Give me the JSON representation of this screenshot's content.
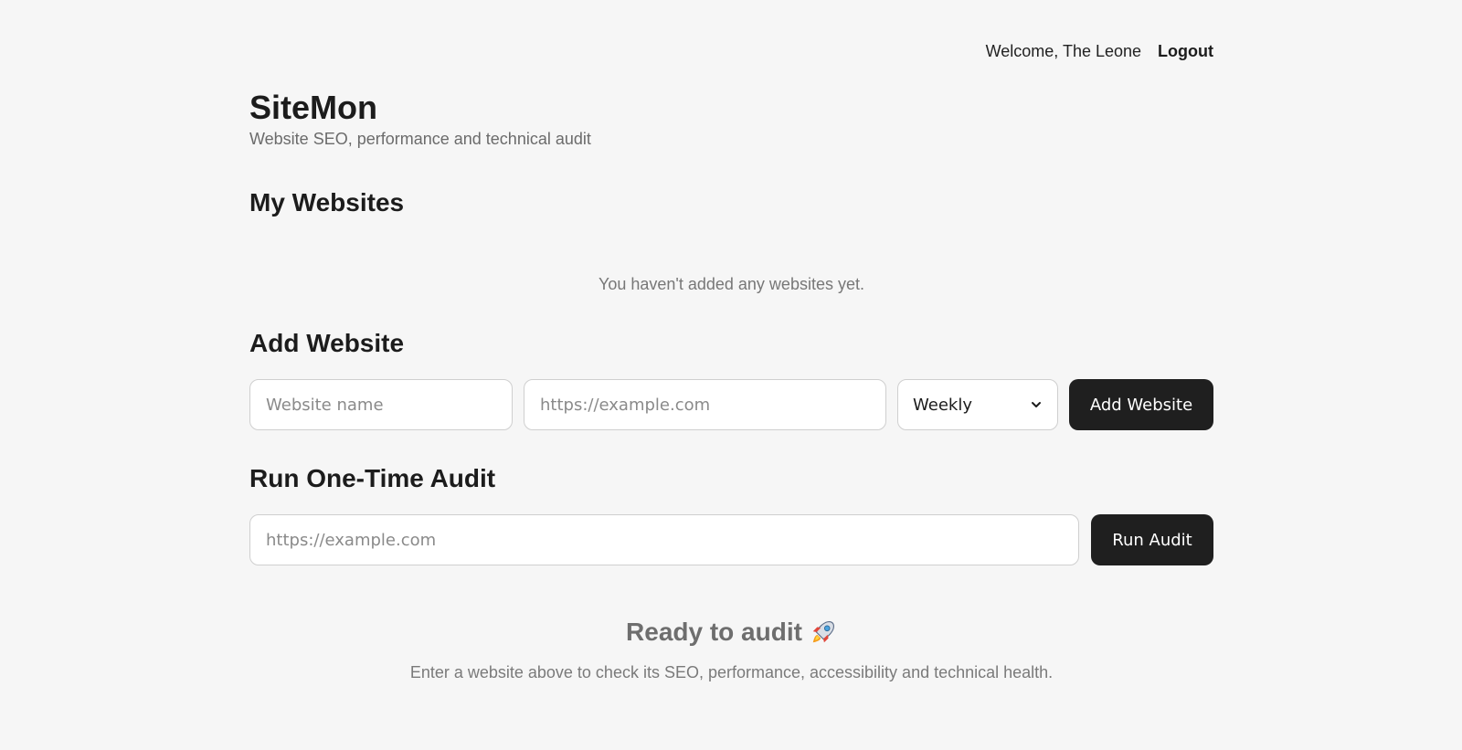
{
  "header": {
    "welcome_text": "Welcome, The Leone",
    "logout_label": "Logout"
  },
  "brand": {
    "title": "SiteMon",
    "subtitle": "Website SEO, performance and technical audit"
  },
  "my_websites": {
    "heading": "My Websites",
    "empty_message": "You haven't added any websites yet."
  },
  "add_website": {
    "heading": "Add Website",
    "name_placeholder": "Website name",
    "name_value": "",
    "url_placeholder": "https://example.com",
    "url_value": "",
    "frequency_selected": "Weekly",
    "submit_label": "Add Website"
  },
  "one_time_audit": {
    "heading": "Run One-Time Audit",
    "url_placeholder": "https://example.com",
    "url_value": "",
    "submit_label": "Run Audit"
  },
  "empty_state": {
    "title": "Ready to audit",
    "icon": "rocket-icon",
    "message": "Enter a website above to check its SEO, performance, accessibility and technical health."
  },
  "colors": {
    "background": "#f6f6f6",
    "primary_button": "#1f1f1f",
    "text_primary": "#1c1c1c",
    "text_muted": "#6b6b6b"
  }
}
